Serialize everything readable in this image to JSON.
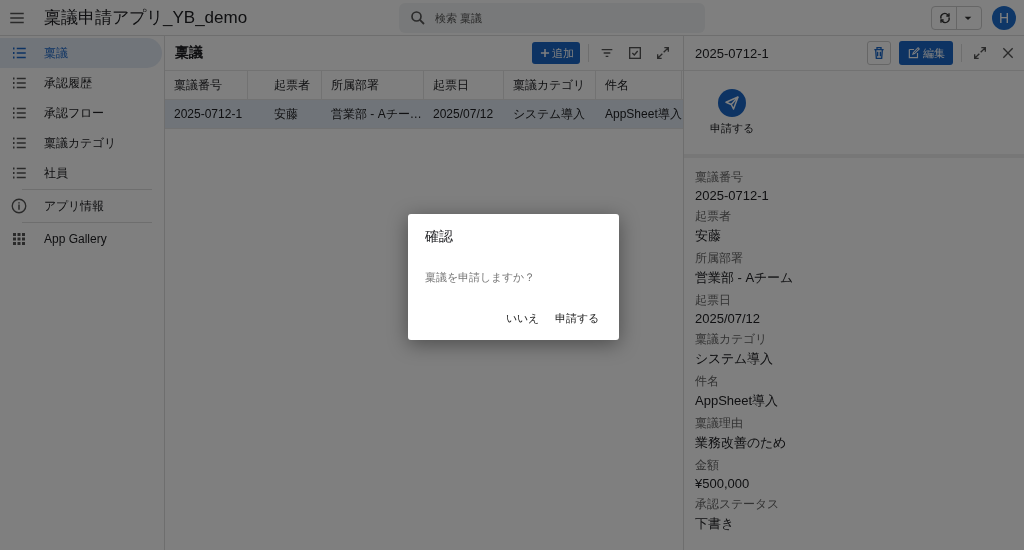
{
  "app_bar": {
    "title": "稟議申請アプリ_YB_demo",
    "search": {
      "placeholder": "検索 稟議"
    },
    "avatar": "H"
  },
  "sidebar": {
    "items": [
      {
        "label": "稟議",
        "kind": "list",
        "selected": true
      },
      {
        "label": "承認履歴",
        "kind": "list",
        "selected": false
      },
      {
        "label": "承認フロー",
        "kind": "list",
        "selected": false
      },
      {
        "label": "稟議カテゴリ",
        "kind": "list",
        "selected": false
      },
      {
        "label": "社員",
        "kind": "list",
        "selected": false
      },
      {
        "label": "アプリ情報",
        "kind": "info",
        "selected": false
      },
      {
        "label": "App Gallery",
        "kind": "grid",
        "selected": false
      }
    ]
  },
  "list_view": {
    "title": "稟議",
    "add_button": "追加",
    "table": {
      "columns": [
        "稟議番号",
        "起票者",
        "所属部署",
        "起票日",
        "稟議カテゴリ",
        "件名"
      ],
      "rows": [
        {
          "selected": true,
          "cells": [
            "2025-0712-1",
            "安藤",
            "営業部 - Aチー…",
            "2025/07/12",
            "システム導入",
            "AppSheet導入"
          ]
        }
      ]
    }
  },
  "detail": {
    "title": "2025-0712-1",
    "edit_button": "編集",
    "action": "申請する",
    "fields": [
      {
        "label": "稟議番号",
        "value": "2025-0712-1"
      },
      {
        "label": "起票者",
        "value": "安藤"
      },
      {
        "label": "所属部署",
        "value": "営業部 - Aチーム"
      },
      {
        "label": "起票日",
        "value": "2025/07/12"
      },
      {
        "label": "稟議カテゴリ",
        "value": "システム導入"
      },
      {
        "label": "件名",
        "value": "AppSheet導入"
      },
      {
        "label": "稟議理由",
        "value": "業務改善のため"
      },
      {
        "label": "金額",
        "value": "¥500,000"
      },
      {
        "label": "承認ステータス",
        "value": "下書き"
      }
    ]
  },
  "dialog": {
    "title": "確認",
    "message": "稟議を申請しますか？",
    "buttons": [
      "いいえ",
      "申請する"
    ]
  }
}
